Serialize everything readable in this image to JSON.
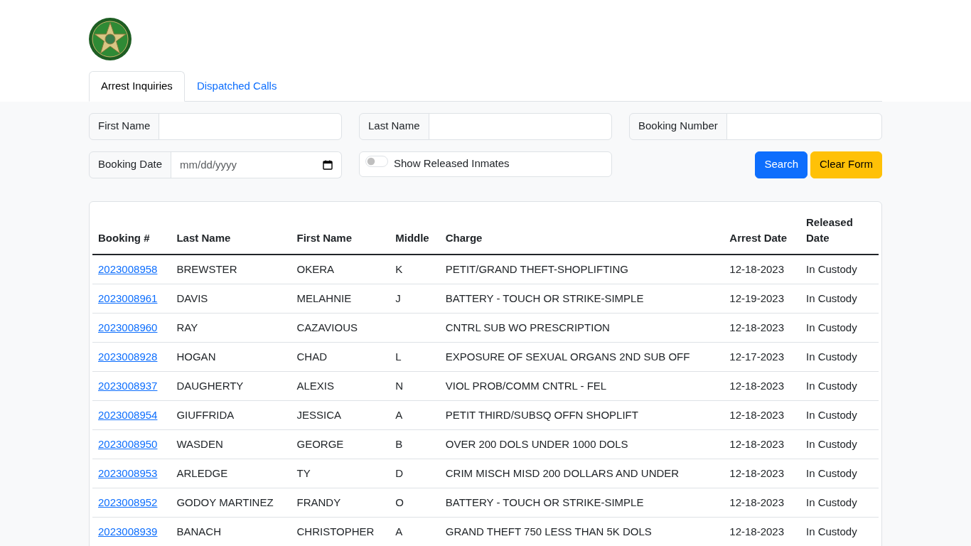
{
  "tabs": [
    {
      "label": "Arrest Inquiries",
      "selected": true
    },
    {
      "label": "Dispatched Calls",
      "selected": false
    }
  ],
  "fields": [
    {
      "label": "First Name",
      "kind": "text"
    },
    {
      "label": "Last Name",
      "kind": "text"
    },
    {
      "label": "Booking Number",
      "kind": "text"
    },
    {
      "label": "Booking Date",
      "kind": "date",
      "placeholder": "mm/dd/yyyy"
    }
  ],
  "released_switch": {
    "label": "Show Released Inmates",
    "on": false
  },
  "buttons": [
    {
      "label": "Search",
      "kind": "primary"
    },
    {
      "label": "Clear Form",
      "kind": "warning"
    }
  ],
  "table": {
    "columns": [
      "Booking #",
      "Last Name",
      "First Name",
      "Middle",
      "Charge",
      "Arrest Date",
      "Released Date"
    ],
    "rows": [
      [
        "2023008958",
        "BREWSTER",
        "OKERA",
        "K",
        "PETIT/GRAND THEFT-SHOPLIFTING",
        "12-18-2023",
        "In Custody"
      ],
      [
        "2023008961",
        "DAVIS",
        "MELAHNIE",
        "J",
        "BATTERY - TOUCH OR STRIKE-SIMPLE",
        "12-19-2023",
        "In Custody"
      ],
      [
        "2023008960",
        "RAY",
        "CAZAVIOUS",
        "",
        "CNTRL SUB WO PRESCRIPTION",
        "12-18-2023",
        "In Custody"
      ],
      [
        "2023008928",
        "HOGAN",
        "CHAD",
        "L",
        "EXPOSURE OF SEXUAL ORGANS 2ND SUB OFF",
        "12-17-2023",
        "In Custody"
      ],
      [
        "2023008937",
        "DAUGHERTY",
        "ALEXIS",
        "N",
        "VIOL PROB/COMM CNTRL - FEL",
        "12-18-2023",
        "In Custody"
      ],
      [
        "2023008954",
        "GIUFFRIDA",
        "JESSICA",
        "A",
        "PETIT THIRD/SUBSQ OFFN SHOPLIFT",
        "12-18-2023",
        "In Custody"
      ],
      [
        "2023008950",
        "WASDEN",
        "GEORGE",
        "B",
        "OVER 200 DOLS UNDER 1000 DOLS",
        "12-18-2023",
        "In Custody"
      ],
      [
        "2023008953",
        "ARLEDGE",
        "TY",
        "D",
        "CRIM MISCH MISD 200 DOLLARS AND UNDER",
        "12-18-2023",
        "In Custody"
      ],
      [
        "2023008952",
        "GODOY MARTINEZ",
        "FRANDY",
        "O",
        "BATTERY - TOUCH OR STRIKE-SIMPLE",
        "12-18-2023",
        "In Custody"
      ],
      [
        "2023008939",
        "BANACH",
        "CHRISTOPHER",
        "A",
        "GRAND THEFT 750 LESS THAN 5K DOLS",
        "12-18-2023",
        "In Custody"
      ]
    ]
  }
}
